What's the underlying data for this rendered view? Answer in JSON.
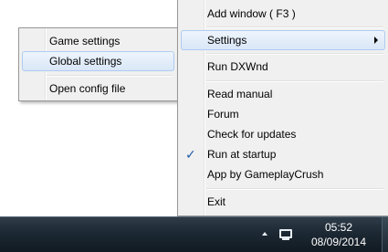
{
  "main_menu": {
    "items": [
      {
        "label": "Add window ( F3 )"
      },
      {
        "label": "Settings"
      },
      {
        "label": "Run DXWnd"
      },
      {
        "label": "Read manual"
      },
      {
        "label": "Forum"
      },
      {
        "label": "Check for updates"
      },
      {
        "label": "Run at startup",
        "checked": true
      },
      {
        "label": "App by GameplayCrush"
      },
      {
        "label": "Exit"
      }
    ]
  },
  "settings_submenu": {
    "items": [
      {
        "label": "Game settings"
      },
      {
        "label": "Global settings"
      },
      {
        "label": "Open config file"
      }
    ]
  },
  "taskbar": {
    "clock_time": "05:52",
    "clock_date": "08/09/2014"
  },
  "icons": {
    "check": "✓",
    "tray_arrow": "show-hidden-icons-arrow",
    "network": "monitor-icon"
  }
}
